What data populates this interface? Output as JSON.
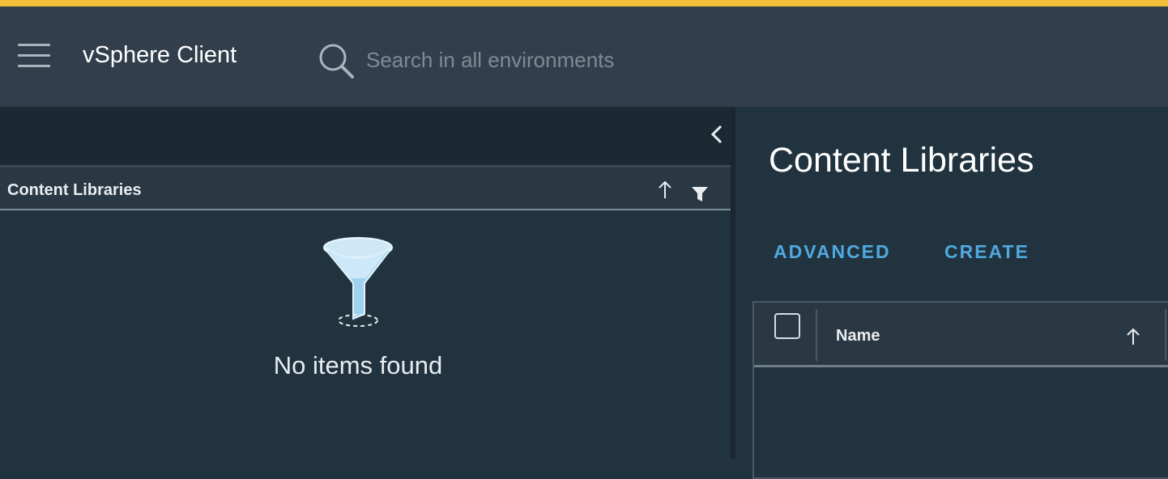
{
  "header": {
    "app_title": "vSphere Client",
    "search_placeholder": "Search in all environments"
  },
  "left_panel": {
    "title": "Content Libraries",
    "empty_message": "No items found"
  },
  "main": {
    "page_title": "Content Libraries",
    "actions": {
      "advanced": "ADVANCED",
      "create": "CREATE"
    },
    "grid": {
      "columns": [
        "Name"
      ]
    }
  },
  "icons": {
    "menu": "hamburger-menu-icon",
    "search": "search-icon",
    "collapse": "chevron-left-icon",
    "sort": "arrow-up-icon",
    "filter": "filter-icon",
    "empty": "funnel-illustration"
  },
  "colors": {
    "accent_stripe": "#f4bf3a",
    "header_bg": "#323e4b",
    "link_blue": "#4fa9e0"
  }
}
